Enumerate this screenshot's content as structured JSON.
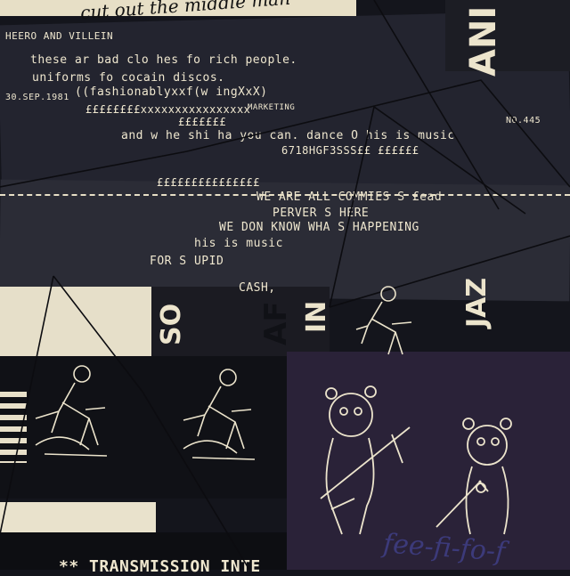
{
  "handwriting": {
    "top": "cut out the middle man",
    "bottom": "fee-fi-fo-f"
  },
  "header_left": "HEERO AND VILLEIN",
  "date": "30.SEP.1981",
  "marketing": "MARKETING",
  "ref_no": "NO.445",
  "lines": [
    "these ar bad clo hes fo rich people.",
    "uniforms fo cocain discos.",
    "((fashionablyxxf(w ingXxX)",
    "££££££££xxxxxxxxxxxxxxxx",
    "£££££££",
    "and w he shi ha you can. dance O his is music",
    "6718HGF3SSS££ ££££££",
    "£££££££££££££££",
    "WE ARE ALL COMMIES S  £ead",
    "PERVER S HERE",
    "WE DON  KNOW WHA S HAPPENING",
    "his is music",
    "FOR S UPID",
    "CASH,"
  ],
  "vertical_words": [
    "SO",
    "AF",
    "IN",
    "JAZ"
  ],
  "right_edge_word": "ANI",
  "footer": "** TRANSMISSION INTE"
}
